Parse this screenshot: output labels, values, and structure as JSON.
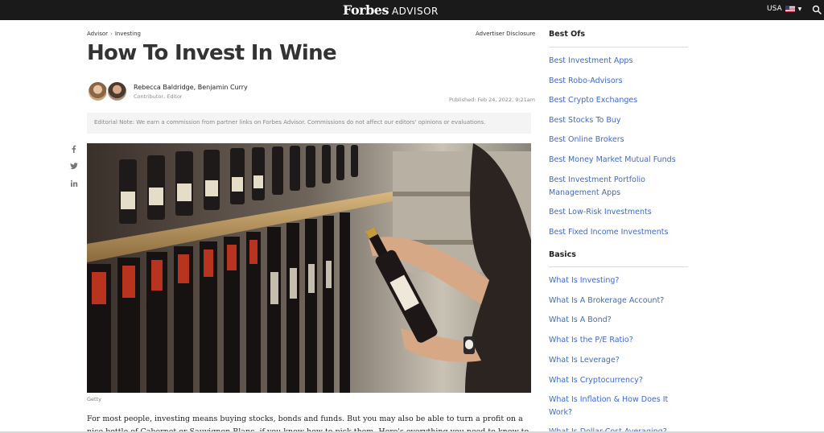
{
  "header": {
    "brand_main": "Forbes",
    "brand_sub": "ADVISOR",
    "region_label": "USA",
    "region_flag_icon": "us-flag-icon",
    "search_icon": "search-icon"
  },
  "breadcrumb": {
    "items": [
      "Advisor",
      "Investing"
    ],
    "separator": "›"
  },
  "disclosure_label": "Advertiser Disclosure",
  "article": {
    "title": "How To Invest In Wine",
    "authors": "Rebecca Baldridge,  Benjamin Curry",
    "roles": "Contributor,  Editor",
    "published": "Published: Feb 24, 2022, 9:21am",
    "editorial_note": "Editorial Note: We earn a commission from partner links on Forbes Advisor. Commissions do not affect our editors' opinions or evaluations.",
    "image_credit": "Getty",
    "intro": "For most people, investing means buying stocks, bonds and funds. But you may also be able to turn a profit on a nice bottle of Cabernet or Sauvignon Blanc, if you know how to pick them. Here's everything you need to know to invest in"
  },
  "share_icons": [
    "facebook-icon",
    "twitter-icon",
    "linkedin-icon"
  ],
  "sidebar": {
    "best_ofs": {
      "heading": "Best Ofs",
      "links": [
        "Best Investment Apps",
        "Best Robo-Advisors",
        "Best Crypto Exchanges",
        "Best Stocks To Buy",
        "Best Online Brokers",
        "Best Money Market Mutual Funds",
        "Best Investment Portfolio Management Apps",
        "Best Low-Risk Investments",
        "Best Fixed Income Investments"
      ]
    },
    "basics": {
      "heading": "Basics",
      "links": [
        "What Is Investing?",
        "What Is A Brokerage Account?",
        "What Is A Bond?",
        "What Is the P/E Ratio?",
        "What Is Leverage?",
        "What Is Cryptocurrency?",
        "What Is Inflation & How Does It Work?",
        "What Is Dollar-Cost Averaging?"
      ]
    }
  },
  "colors": {
    "topbar": "#1a1a1a",
    "link": "#3e6ac8",
    "title": "#333333"
  }
}
